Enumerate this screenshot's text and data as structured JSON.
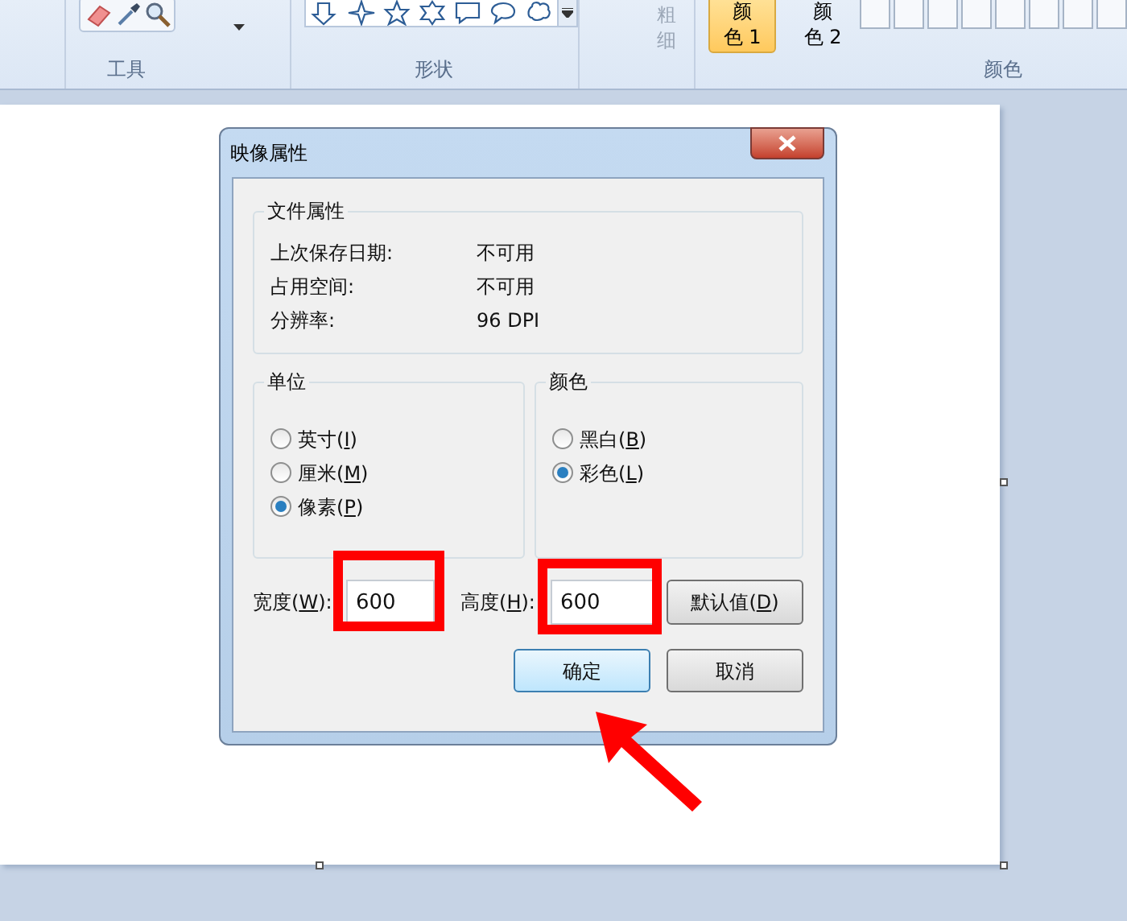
{
  "ribbon": {
    "groups": [
      {
        "label": "工具"
      },
      {
        "label": "形状"
      },
      {
        "label": "颜色"
      }
    ],
    "size": {
      "label": "粗细",
      "disabled": true
    },
    "color_buttons": [
      {
        "label": "颜色 1",
        "selected": true
      },
      {
        "label": "颜色 2",
        "selected": false
      }
    ]
  },
  "dialog": {
    "title": "映像属性",
    "file_group": {
      "title": "文件属性",
      "rows": [
        {
          "label": "上次保存日期:",
          "value": "不可用"
        },
        {
          "label": "占用空间:",
          "value": "不可用"
        },
        {
          "label": "分辨率:",
          "value": "96 DPI"
        }
      ]
    },
    "units": {
      "title": "单位",
      "options": [
        {
          "text": "英寸(",
          "key": "I",
          "tail": ")",
          "selected": false
        },
        {
          "text": "厘米(",
          "key": "M",
          "tail": ")",
          "selected": false
        },
        {
          "text": "像素(",
          "key": "P",
          "tail": ")",
          "selected": true
        }
      ]
    },
    "colors": {
      "title": "颜色",
      "options": [
        {
          "text": "黑白(",
          "key": "B",
          "tail": ")",
          "selected": false
        },
        {
          "text": "彩色(",
          "key": "L",
          "tail": ")",
          "selected": true
        }
      ]
    },
    "width": {
      "text": "宽度(",
      "key": "W",
      "tail": "):",
      "value": "600"
    },
    "height": {
      "text": "高度(",
      "key": "H",
      "tail": "):",
      "value": "600"
    },
    "default_button": {
      "text": "默认值(",
      "key": "D",
      "tail": ")"
    },
    "ok": "确定",
    "cancel": "取消"
  }
}
